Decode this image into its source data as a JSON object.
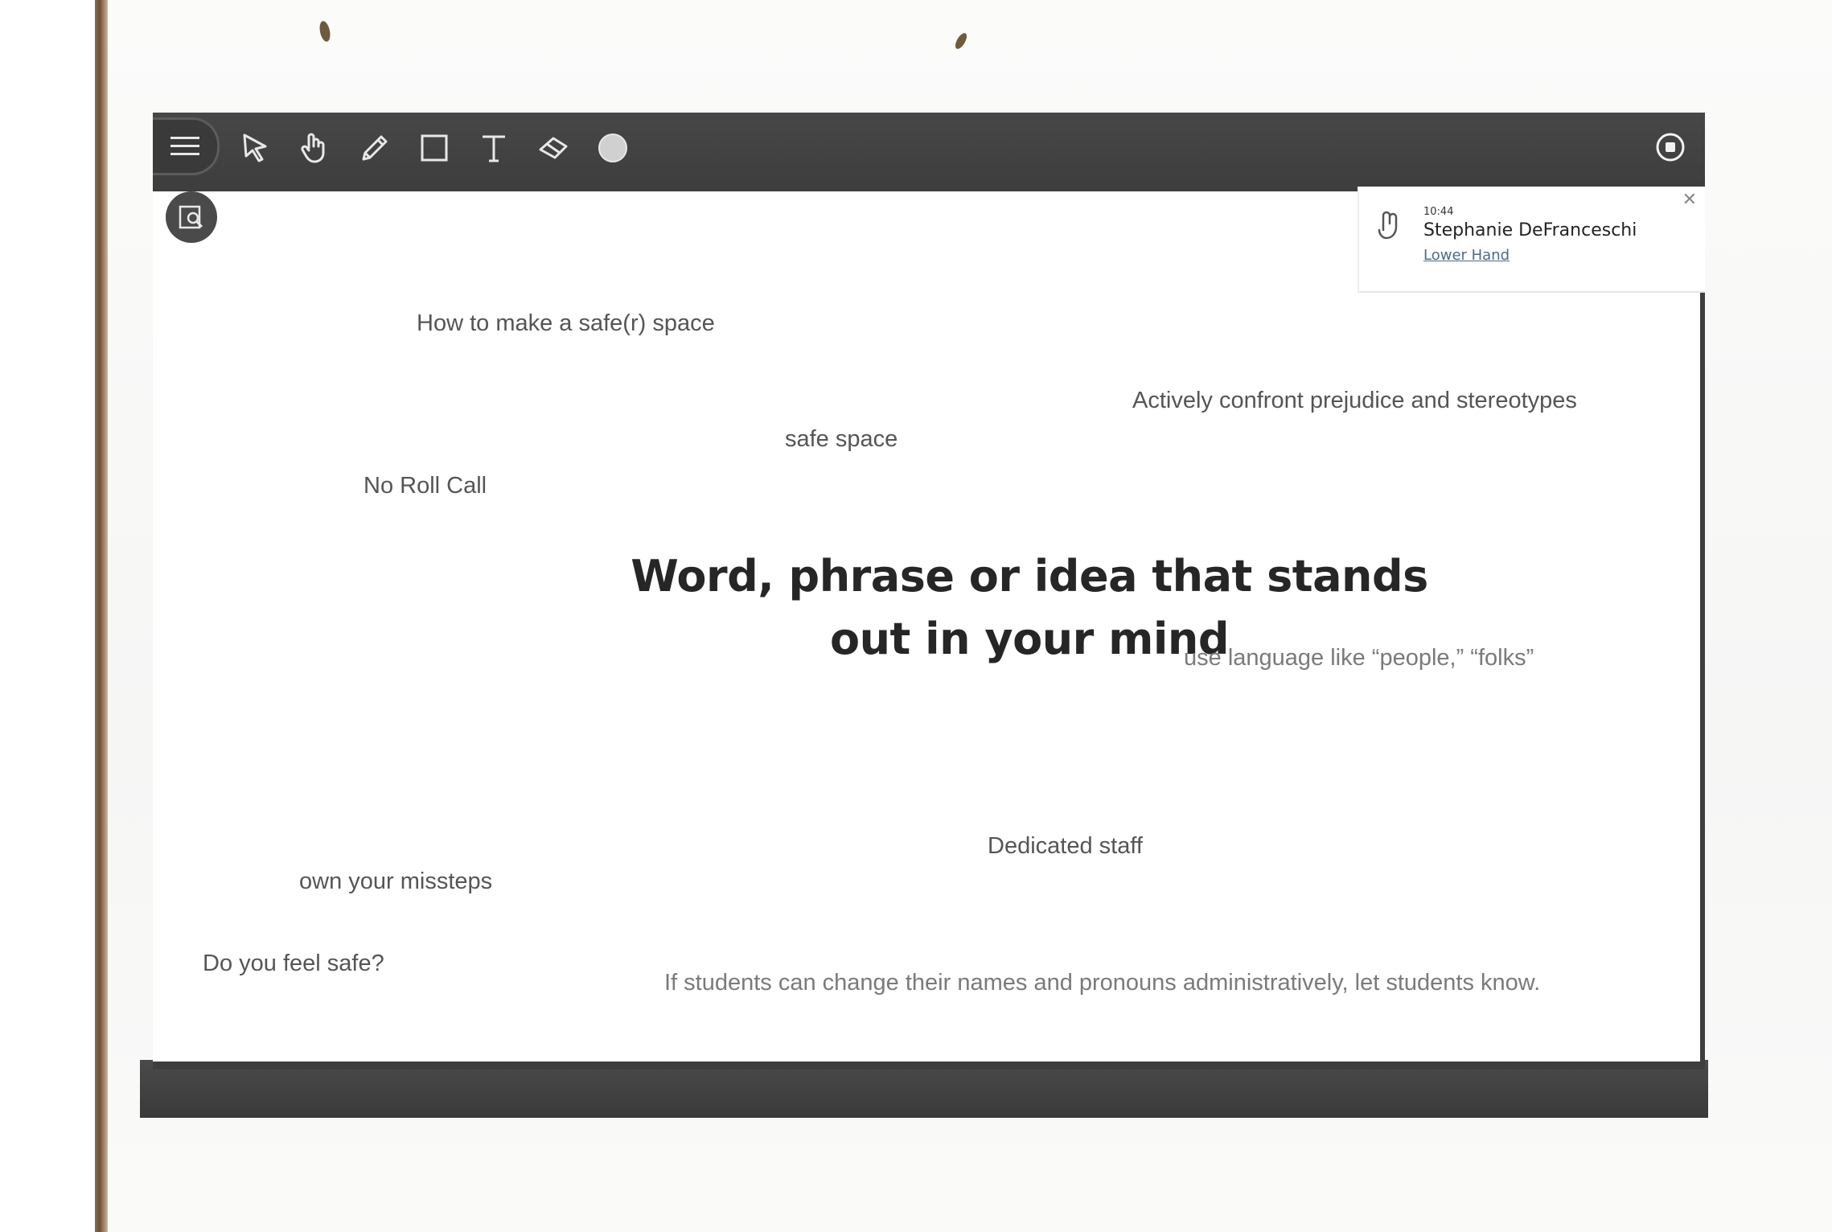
{
  "toolbar": {
    "tools": [
      {
        "icon": "menu-icon"
      },
      {
        "icon": "select-arrow-icon"
      },
      {
        "icon": "pan-hand-icon"
      },
      {
        "icon": "pencil-icon"
      },
      {
        "icon": "rectangle-icon"
      },
      {
        "icon": "text-icon"
      },
      {
        "icon": "eraser-icon"
      },
      {
        "icon": "color-dot-icon"
      }
    ],
    "record_icon": "record-icon"
  },
  "canvas": {
    "search_icon": "search-icon",
    "headline_line1": "Word, phrase or idea that stands",
    "headline_line2": "out in your mind",
    "responses": [
      "How to make a safe(r) space",
      "Actively confront prejudice and stereotypes",
      "safe space",
      "No Roll Call",
      "use language like “people,” “folks”",
      "Dedicated staff",
      "own your missteps",
      "Do you feel safe?",
      "If students can change their names and pronouns administratively, let students know."
    ]
  },
  "notification": {
    "time": "10:44",
    "name": "Stephanie DeFranceschi",
    "action": "Lower Hand",
    "icon": "raised-hand-icon",
    "close_icon": "close-icon"
  },
  "colors": {
    "toolbar": "#3e3e3e",
    "canvas": "#ffffff",
    "headline": "#262626",
    "link": "#4d6a8a"
  }
}
